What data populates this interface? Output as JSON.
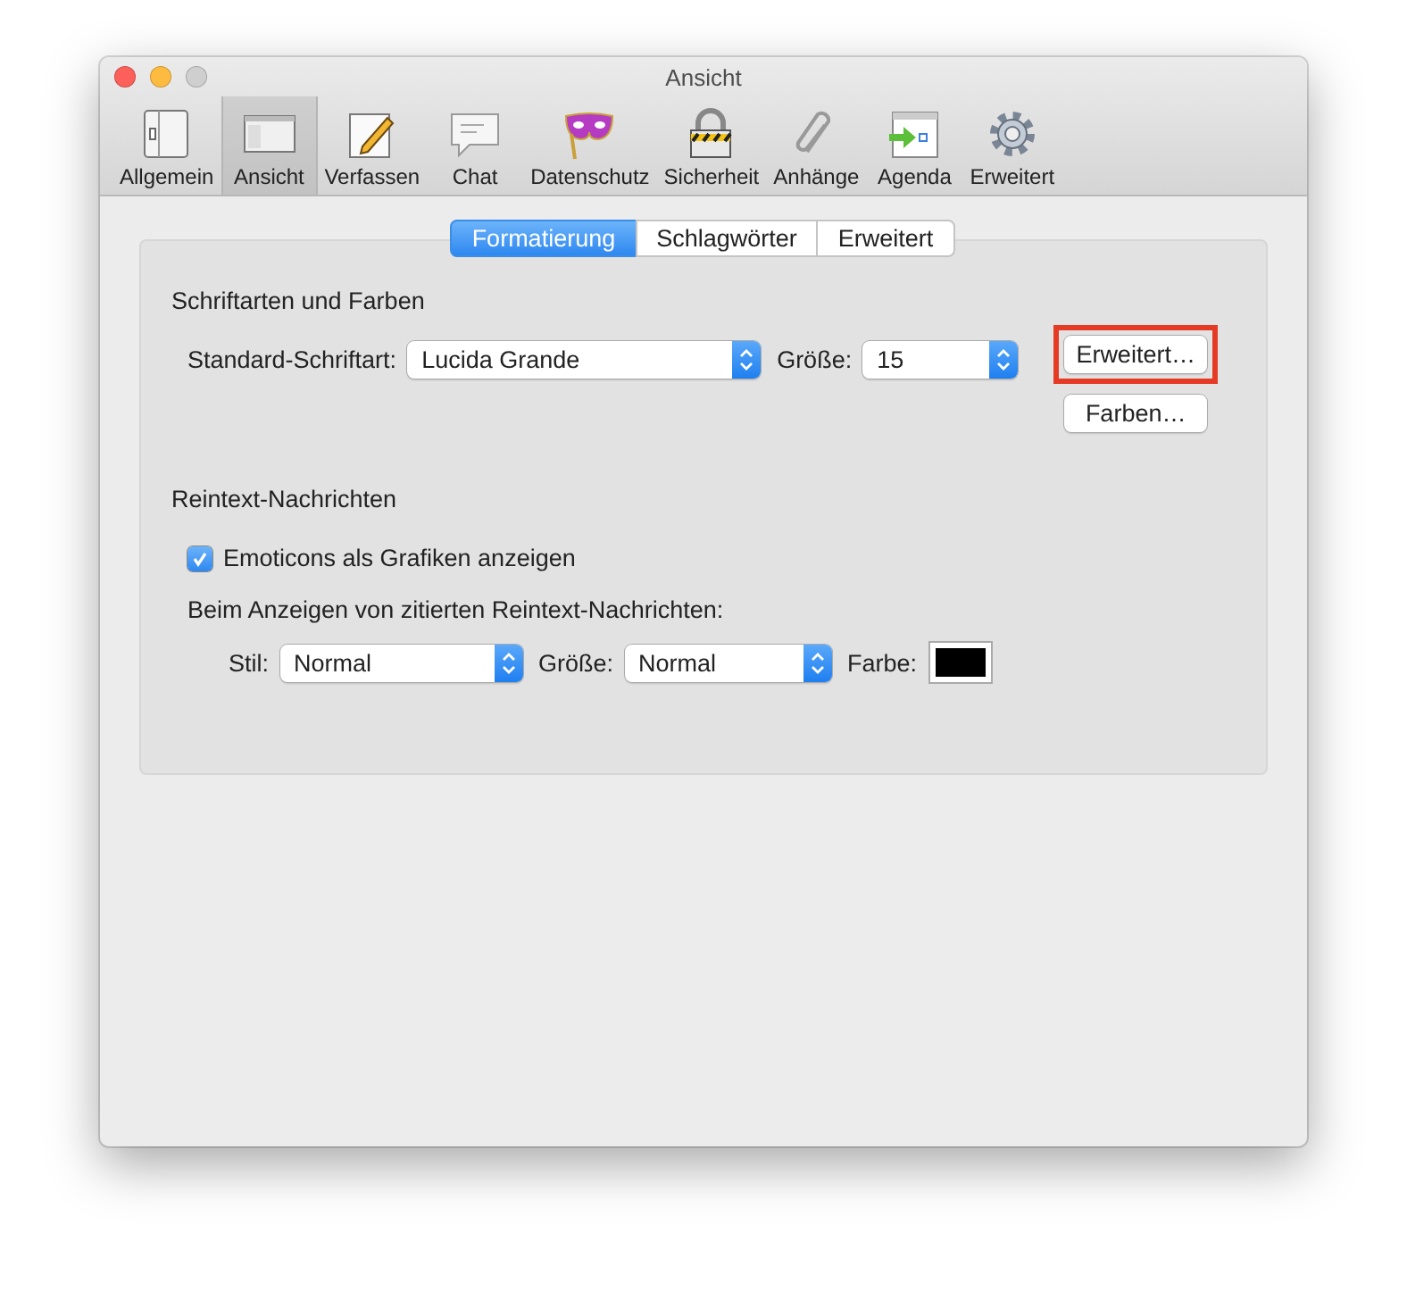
{
  "window": {
    "title": "Ansicht"
  },
  "toolbar": [
    {
      "label": "Allgemein",
      "selected": false
    },
    {
      "label": "Ansicht",
      "selected": true
    },
    {
      "label": "Verfassen",
      "selected": false
    },
    {
      "label": "Chat",
      "selected": false
    },
    {
      "label": "Datenschutz",
      "selected": false
    },
    {
      "label": "Sicherheit",
      "selected": false
    },
    {
      "label": "Anhänge",
      "selected": false
    },
    {
      "label": "Agenda",
      "selected": false
    },
    {
      "label": "Erweitert",
      "selected": false
    }
  ],
  "tabs": [
    {
      "label": "Formatierung",
      "selected": true
    },
    {
      "label": "Schlagwörter",
      "selected": false
    },
    {
      "label": "Erweitert",
      "selected": false
    }
  ],
  "fonts_section": {
    "heading": "Schriftarten und Farben",
    "font_label": "Standard-Schriftart:",
    "font_value": "Lucida Grande",
    "size_label": "Größe:",
    "size_value": "15",
    "buttons": [
      {
        "label": "Erweitert…",
        "highlighted": true
      },
      {
        "label": "Farben…",
        "highlighted": false
      }
    ]
  },
  "plaintext_section": {
    "heading": "Reintext-Nachrichten",
    "emoticons": {
      "label": "Emoticons als Grafiken anzeigen",
      "checked": true
    },
    "quoted_label": "Beim Anzeigen von zitierten Reintext-Nachrichten:",
    "style_label": "Stil:",
    "style_value": "Normal",
    "size_label": "Größe:",
    "size_value": "Normal",
    "color_label": "Farbe:",
    "color": "#000000"
  }
}
